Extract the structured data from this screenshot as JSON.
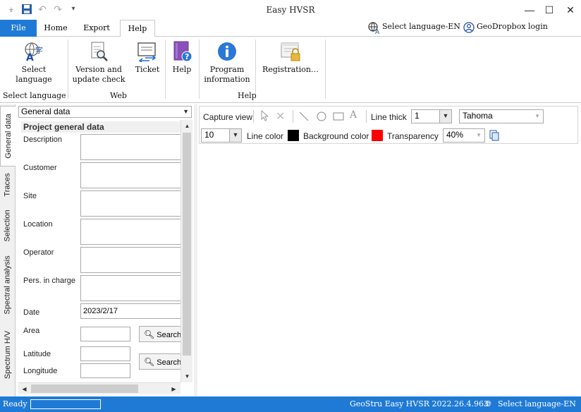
{
  "window": {
    "title": "Easy HVSR"
  },
  "tabs": {
    "file": "File",
    "home": "Home",
    "export": "Export",
    "help": "Help"
  },
  "top_links": {
    "language": "Select language-EN",
    "geodropbox": "GeoDropbox login"
  },
  "ribbon": {
    "select_language": {
      "line1": "Select",
      "line2": "language"
    },
    "version_check": {
      "line1": "Version  and",
      "line2": "update check"
    },
    "ticket": "Ticket",
    "help": "Help",
    "program_info": {
      "line1": "Program",
      "line2": "information"
    },
    "registration": "Registration…",
    "groups": {
      "select_language": "Select language",
      "web": "Web",
      "help": "Help"
    }
  },
  "vertical_tabs": [
    "General data",
    "Traces",
    "Selection",
    "Spectral analysis",
    "Spectrum H/V"
  ],
  "panel": {
    "selector": "General data",
    "header": "Project general data",
    "fields": {
      "description": "Description",
      "customer": "Customer",
      "site": "Site",
      "location": "Location",
      "operator": "Operator",
      "pers_in_charge": "Pers. in charge",
      "date": "Date",
      "date_value": "2023/2/17",
      "area": "Area",
      "latitude": "Latitude",
      "longitude": "Longitude"
    },
    "search_label": "Search"
  },
  "toolbar": {
    "capture_view": "Capture view",
    "line_thick_label": "Line thick",
    "line_thick_value": "1",
    "font_value": "Tahoma",
    "font_size_value": "10",
    "line_color_label": "Line color",
    "line_color": "#000000",
    "background_color_label": "Background color",
    "background_color": "#ff0000",
    "transparency_label": "Transparency",
    "transparency_value": "40%"
  },
  "status": {
    "ready": "Ready",
    "version": "GeoStru Easy HVSR 2022.26.4.963",
    "language": "Select language-EN"
  },
  "colors": {
    "accent": "#1f7ad6"
  }
}
